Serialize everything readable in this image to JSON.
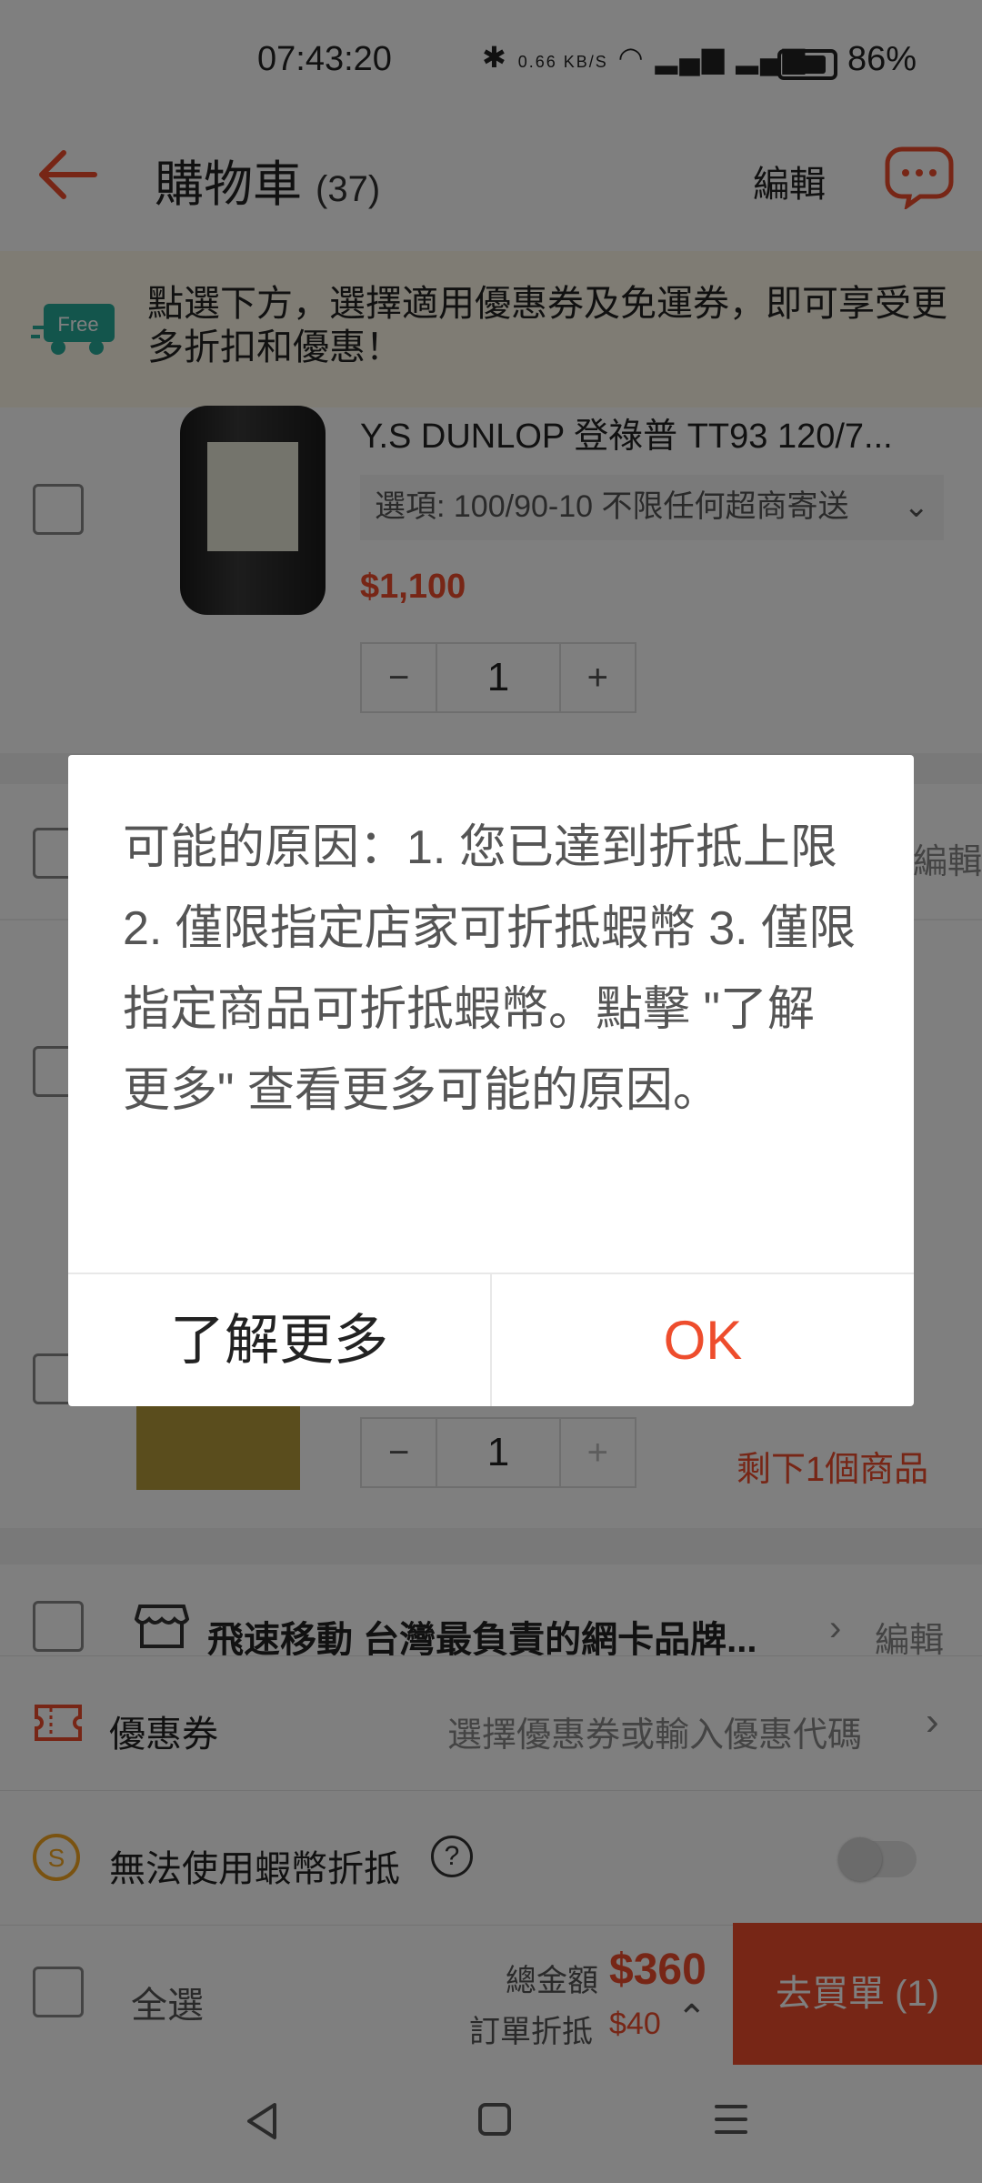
{
  "status_bar": {
    "time": "07:43:20",
    "net_speed": "0.66 KB/S",
    "battery": "86%"
  },
  "header": {
    "title": "購物車",
    "count": "(37)",
    "edit": "編輯"
  },
  "promo": {
    "badge": "Free",
    "text": "點選下方，選擇適用優惠券及免運券，即可享受更多折扣和優惠！"
  },
  "item1": {
    "name": "Y.S DUNLOP 登祿普 TT93 120/7...",
    "variant": "選項: 100/90-10 不限任何超商寄送",
    "price": "$1,100",
    "qty": "1",
    "minus": "−",
    "plus": "+"
  },
  "item2": {
    "edit": "編輯",
    "qty": "1",
    "minus": "−",
    "plus": "+",
    "stock_note": "剩下1個商品"
  },
  "shop3": {
    "name": "飛速移動 台灣最負責的網卡品牌...",
    "edit": "編輯"
  },
  "coupon": {
    "label": "優惠券",
    "hint": "選擇優惠券或輸入優惠代碼"
  },
  "coins": {
    "label": "無法使用蝦幣折抵",
    "help": "?"
  },
  "checkout": {
    "select_all": "全選",
    "total_label": "總金額",
    "total": "$360",
    "discount_label": "訂單折抵",
    "discount": "$40",
    "button": "去買單 (1)"
  },
  "dialog": {
    "message": "可能的原因：1. 您已達到折抵上限 2. 僅限指定店家可折抵蝦幣 3. 僅限指定商品可折抵蝦幣。點擊 \"了解更多\" 查看更多可能的原因。",
    "learn_more": "了解更多",
    "ok": "OK"
  },
  "colors": {
    "accent": "#ee4d2d",
    "promo_bg": "#fff9e8",
    "overlay": "rgba(0,0,0,0.5)"
  }
}
